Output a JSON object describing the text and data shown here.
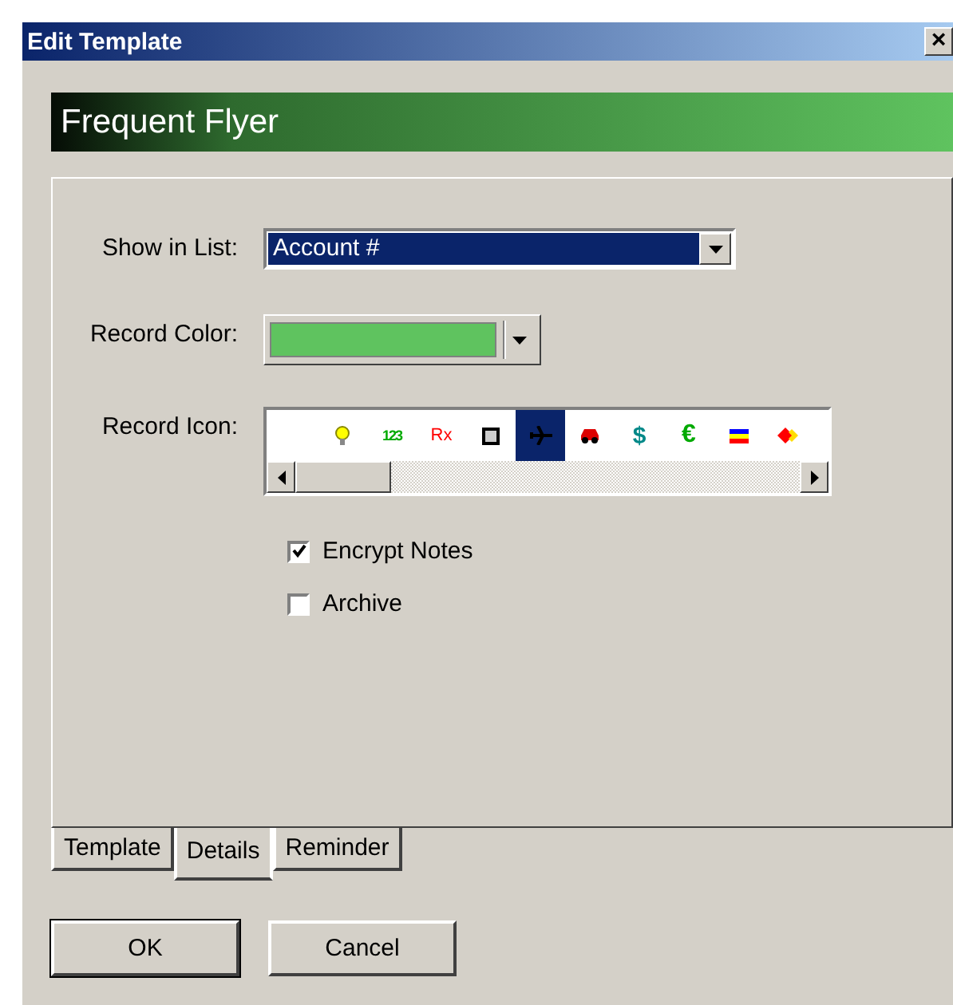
{
  "window": {
    "title": "Edit Template",
    "close": "×"
  },
  "header": "Frequent Flyer",
  "show_in_list": {
    "label": "Show in List:",
    "value": "Account #"
  },
  "record_color": {
    "label": "Record Color:",
    "color": "#5fc35f"
  },
  "record_icon": {
    "label": "Record Icon:",
    "icons": [
      {
        "kind": "bulb",
        "selected": false
      },
      {
        "kind": "numbers",
        "text": "123",
        "selected": false
      },
      {
        "kind": "rx",
        "text": "Rx",
        "selected": false
      },
      {
        "kind": "square",
        "selected": false
      },
      {
        "kind": "plane",
        "selected": true
      },
      {
        "kind": "car",
        "selected": false
      },
      {
        "kind": "dollar",
        "text": "$",
        "selected": false
      },
      {
        "kind": "euro",
        "text": "€",
        "selected": false
      },
      {
        "kind": "flag",
        "selected": false
      },
      {
        "kind": "diamonds",
        "selected": false
      }
    ]
  },
  "checkboxes": [
    {
      "label": "Encrypt Notes",
      "checked": true
    },
    {
      "label": "Archive",
      "checked": false
    }
  ],
  "tabs": [
    {
      "label": "Template",
      "selected": false
    },
    {
      "label": "Details",
      "selected": true
    },
    {
      "label": "Reminder",
      "selected": false
    }
  ],
  "buttons": [
    {
      "label": "OK",
      "default": true
    },
    {
      "label": "Cancel",
      "default": false
    }
  ]
}
